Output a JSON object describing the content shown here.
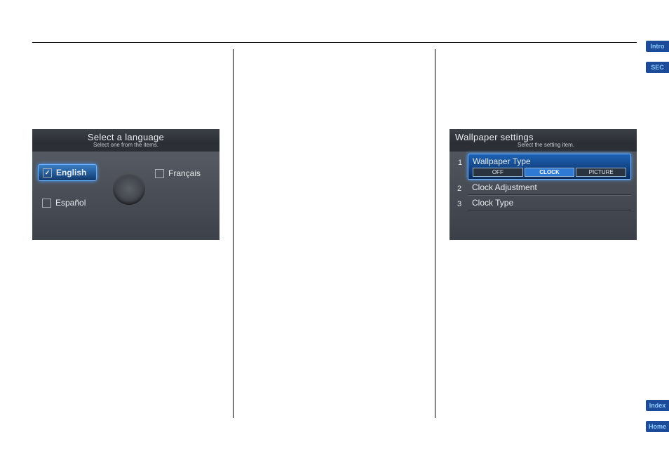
{
  "side_tabs": {
    "intro": "Intro",
    "sec": "SEC",
    "index": "Index",
    "home": "Home"
  },
  "language_screen": {
    "title": "Select a language",
    "subtitle": "Select one from the items.",
    "options": {
      "english": "English",
      "francais": "Français",
      "espanol": "Español"
    },
    "english_check": "✓"
  },
  "wallpaper_screen": {
    "title": "Wallpaper settings",
    "subtitle": "Select the setting item.",
    "items": [
      {
        "num": "1",
        "label": "Wallpaper Type",
        "segs": [
          "OFF",
          "CLOCK",
          "PICTURE"
        ]
      },
      {
        "num": "2",
        "label": "Clock Adjustment"
      },
      {
        "num": "3",
        "label": "Clock Type"
      }
    ]
  }
}
